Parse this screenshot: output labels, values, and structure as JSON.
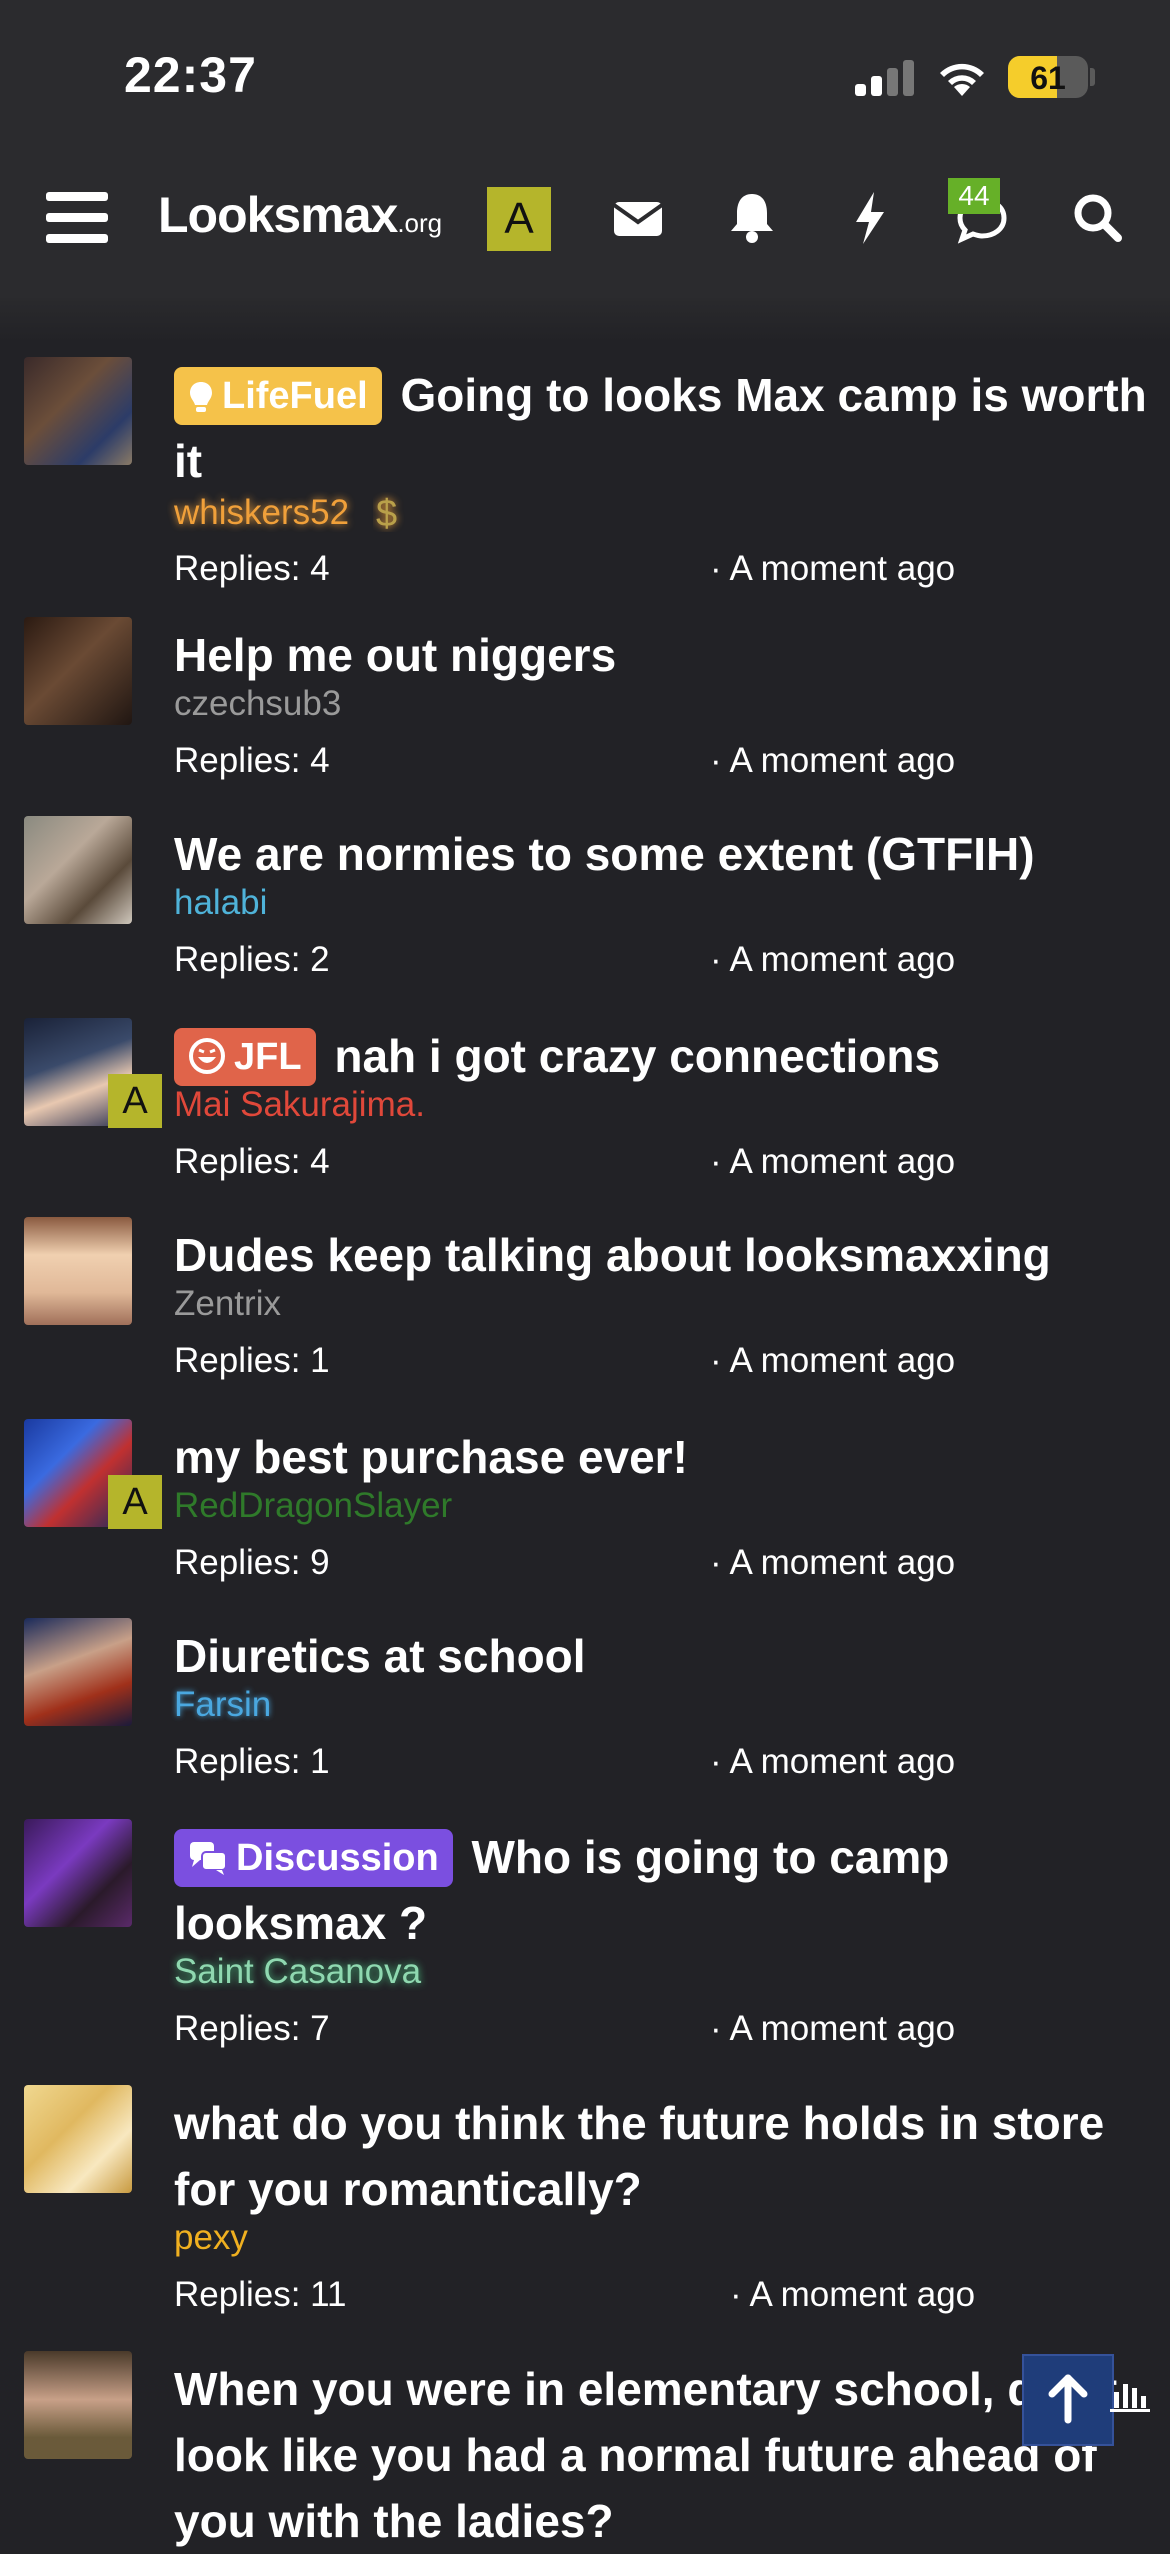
{
  "status_bar": {
    "time": "22:37",
    "battery": "61",
    "battery_level": 0.61
  },
  "header": {
    "logo_main": "Looksmax",
    "logo_suffix": ".org",
    "user_initial": "A",
    "chat_badge": "44",
    "icons": [
      "menu-icon",
      "envelope-icon",
      "bell-icon",
      "lightning-icon",
      "chat-icon",
      "search-icon"
    ]
  },
  "threads": [
    {
      "prefix": "LifeFuel",
      "title": "Going to looks Max camp is worth it",
      "author": "whiskers52",
      "replies": "Replies: 4",
      "time": "· A moment ago"
    },
    {
      "prefix": "",
      "title": "Help me out niggers",
      "author": "czechsub3",
      "replies": "Replies: 4",
      "time": "· A moment ago"
    },
    {
      "prefix": "",
      "title": "We are normies to some extent (GTFIH)",
      "author": "halabi",
      "replies": "Replies: 2",
      "time": "· A moment ago"
    },
    {
      "prefix": "JFL",
      "title": "nah i got crazy connections",
      "author": "Mai Sakurajima.",
      "replies": "Replies: 4",
      "time": "· A moment ago",
      "badge": "A"
    },
    {
      "prefix": "",
      "title": "Dudes keep talking about looksmaxxing",
      "author": "Zentrix",
      "replies": "Replies: 1",
      "time": "· A moment ago"
    },
    {
      "prefix": "",
      "title": "my best purchase ever!",
      "author": "RedDragonSlayer",
      "replies": "Replies: 9",
      "time": "· A moment ago",
      "badge": "A"
    },
    {
      "prefix": "",
      "title": "Diuretics at school",
      "author": "Farsin",
      "replies": "Replies: 1",
      "time": "· A moment ago"
    },
    {
      "prefix": "Discussion",
      "title": "Who is going to camp looksmax ?",
      "author": "Saint Casanova",
      "replies": "Replies: 7",
      "time": "· A moment ago"
    },
    {
      "prefix": "",
      "title": "what do you think the future holds in store for you romantically?",
      "author": "pexy",
      "replies": "Replies: 11",
      "time": "· A moment ago"
    },
    {
      "prefix": "",
      "title": "When you were in elementary school, did it look like you had a normal future ahead of you with the ladies?",
      "author": "",
      "replies": "",
      "time": ""
    }
  ],
  "colors": {
    "background": "#222226",
    "header": "#2b2b2e",
    "lifefuel": "#f5c24a",
    "jfl": "#e0644a",
    "discussion": "#7b4fe0",
    "badge_green": "#66b028"
  }
}
